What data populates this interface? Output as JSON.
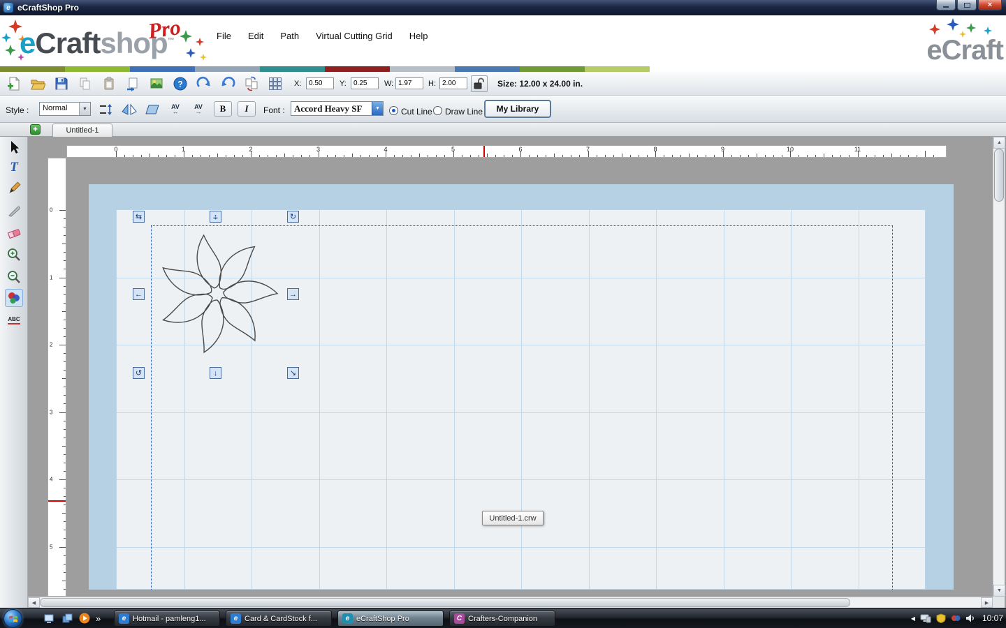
{
  "window": {
    "title": "eCraftShop Pro",
    "app_icon_letter": "e",
    "close_glyph": "×"
  },
  "logo": {
    "brand_e": "e",
    "brand_craft": "Craft",
    "brand_shop": "shop",
    "tm": "™",
    "pro": "Pro",
    "right_brand": "eCraft"
  },
  "menu": {
    "items": [
      "File",
      "Edit",
      "Path",
      "Virtual Cutting Grid",
      "Help"
    ]
  },
  "toolbar": {
    "x_label": "X:",
    "x_value": "0.50",
    "y_label": "Y:",
    "y_value": "0.25",
    "w_label": "W:",
    "w_value": "1.97",
    "h_label": "H:",
    "h_value": "2.00",
    "size_label": "Size: 12.00 x 24.00 in."
  },
  "format": {
    "style_label": "Style :",
    "style_value": "Normal",
    "kern_text": "AV",
    "kern_arrow": "↔",
    "kern_arrow2": "→",
    "bold_label": "B",
    "italic_label": "I",
    "font_label": "Font :",
    "font_value": "Accord Heavy SF",
    "cut_line": "Cut Line",
    "draw_line": "Draw Line",
    "library_button": "My Library",
    "dropdown_arrow": "▼"
  },
  "tabs": {
    "add_label": "+",
    "active": "Untitled-1"
  },
  "palette": {
    "abc_label": "ABC"
  },
  "ruler": {
    "h_numbers": [
      "0",
      "1",
      "2",
      "3",
      "4",
      "5",
      "6",
      "7",
      "8",
      "9",
      "10",
      "11"
    ],
    "v_numbers": [
      "0",
      "1",
      "2",
      "3",
      "4",
      "5"
    ]
  },
  "canvas": {
    "tooltip": "Untitled-1.crw"
  },
  "handles": {
    "flip": "⇆",
    "move_h": "↔",
    "move_v": "↕",
    "rotate_cw": "↻",
    "left": "←",
    "right": "→",
    "rotate_ccw": "↺",
    "down": "↓",
    "resize": "↘"
  },
  "scrollbar": {
    "up": "▲",
    "down": "▼",
    "left": "◀",
    "right": "▶"
  },
  "colors": {
    "strip": [
      "#7d8c2f",
      "#8fb832",
      "#3f6fb5",
      "#93a5b5",
      "#2f8f8f",
      "#8f2020",
      "#b5bec6",
      "#4a78b0",
      "#6f9a35",
      "#b5cc66"
    ],
    "accent_blue": "#2a6db5",
    "selection_blue": "#2a4a9a"
  },
  "taskbar": {
    "overflow": "»",
    "tray_expand": "◀",
    "clock": "10:07",
    "tasks": [
      {
        "label": "Hotmail - pamleng1...",
        "letter": "e",
        "color": "#2d7dd2",
        "active": false
      },
      {
        "label": "Card & CardStock f...",
        "letter": "e",
        "color": "#2d7dd2",
        "active": false
      },
      {
        "label": "eCraftShop Pro",
        "letter": "e",
        "color": "#1f8faf",
        "active": true
      },
      {
        "label": "Crafters-Companion",
        "letter": "C",
        "color": "#a84a9a",
        "active": false
      }
    ]
  }
}
